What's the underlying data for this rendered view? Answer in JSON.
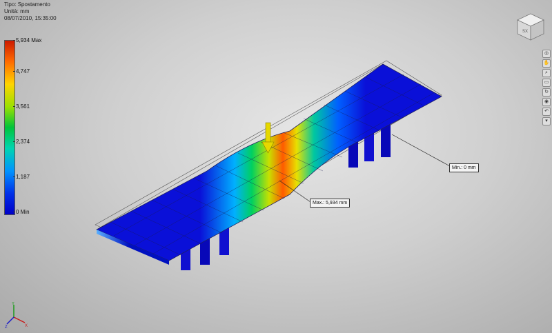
{
  "info": {
    "type": "Tipo: Spostamento",
    "unit": "Unità: mm",
    "datetime": "08/07/2010, 15:35:00"
  },
  "legend": {
    "max_label": "5,934 Max",
    "ticks": [
      "4,747",
      "3,561",
      "2,374",
      "1,187"
    ],
    "min_label": "0 Min"
  },
  "callouts": {
    "max": "Max.: 5,934 mm",
    "min": "Min.: 0 mm"
  },
  "viewcube": {
    "face_label": "SX"
  },
  "navbar": {
    "buttons": [
      "full-navigation",
      "pan",
      "zoom",
      "zoom-window",
      "orbit",
      "look-at",
      "rewind",
      "more"
    ]
  },
  "colors": {
    "max_red": "#cc1a00",
    "mid_green": "#00c43c",
    "min_blue": "#0000c8",
    "load_arrow": "#e6d800"
  }
}
